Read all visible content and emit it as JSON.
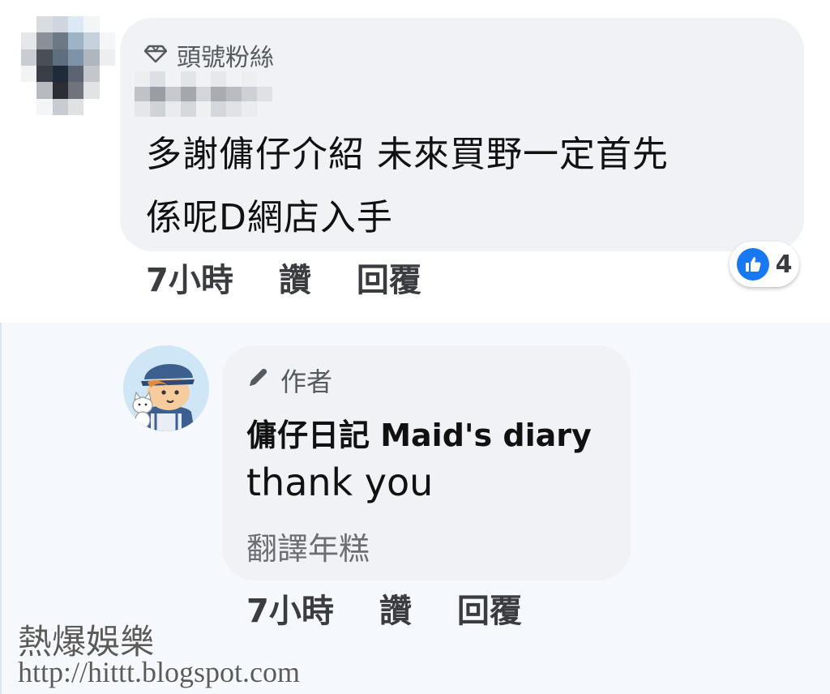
{
  "comment": {
    "badge_label": "頭號粉絲",
    "badge_icon": "diamond-icon",
    "text": "多謝傭仔介紹 未來買野一定首先\n係呢D網店入手",
    "time": "7小時",
    "like_label": "讚",
    "reply_label": "回覆",
    "reaction": {
      "icon": "thumbs-up-icon",
      "count": "4",
      "color": "#1877f2"
    }
  },
  "reply": {
    "badge_label": "作者",
    "badge_icon": "pencil-icon",
    "author_name": "傭仔日記 Maid's diary",
    "text": "thank you",
    "translate_label": "翻譯年糕",
    "time": "7小時",
    "like_label": "讚",
    "reply_label": "回覆"
  },
  "watermark": {
    "line1": "熱爆娛樂",
    "line2": "http://hittt.blogspot.com"
  }
}
